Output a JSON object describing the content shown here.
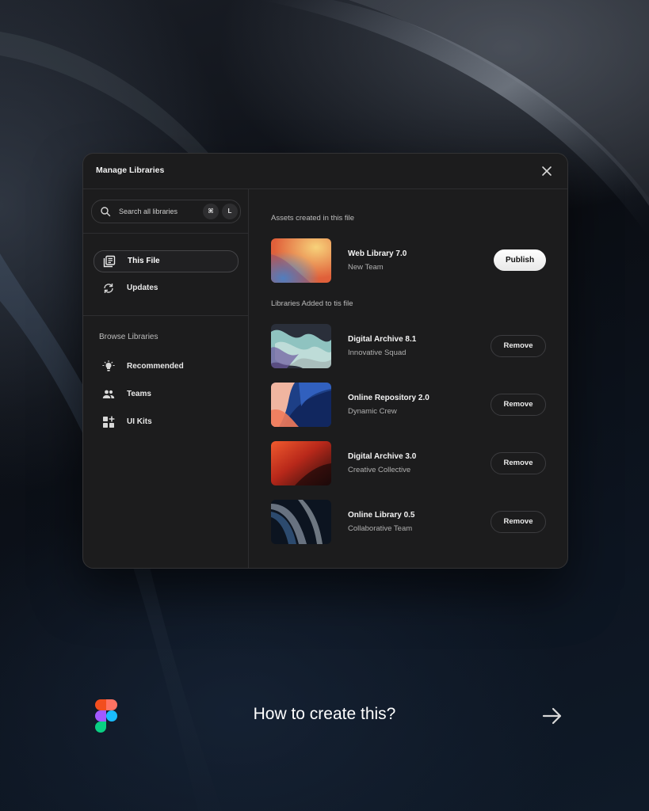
{
  "modal": {
    "title": "Manage Libraries"
  },
  "search": {
    "placeholder": "Search all libraries",
    "shortcut_cmd": "⌘",
    "shortcut_key": "L"
  },
  "nav": {
    "this_file": "This File",
    "updates": "Updates"
  },
  "browse": {
    "heading": "Browse Libraries",
    "items": [
      {
        "label": "Recommended",
        "icon": "lightbulb-icon"
      },
      {
        "label": "Teams",
        "icon": "people-icon"
      },
      {
        "label": "UI Kits",
        "icon": "grid-plus-icon"
      }
    ]
  },
  "assets": {
    "heading": "Assets created in this file",
    "library": {
      "name": "Web Library 7.0",
      "team": "New Team",
      "action": "Publish"
    }
  },
  "added": {
    "heading": "Libraries Added to tis file",
    "libraries": [
      {
        "name": "Digital Archive 8.1",
        "team": "Innovative Squad",
        "action": "Remove"
      },
      {
        "name": "Online Repository 2.0",
        "team": "Dynamic Crew",
        "action": "Remove"
      },
      {
        "name": "Digital Archive 3.0",
        "team": "Creative Collective",
        "action": "Remove"
      },
      {
        "name": "Online Library 0.5",
        "team": "Collaborative Team",
        "action": "Remove"
      }
    ]
  },
  "footer": {
    "cta": "How to create this?"
  },
  "colors": {
    "modal_bg": "#1c1c1d",
    "border": "#2e2e30",
    "publish_bg": "#ffffff",
    "figma_red": "#f24e1e",
    "figma_orange": "#ff7262",
    "figma_purple": "#a259ff",
    "figma_blue": "#1abcfe",
    "figma_green": "#0acf83"
  }
}
